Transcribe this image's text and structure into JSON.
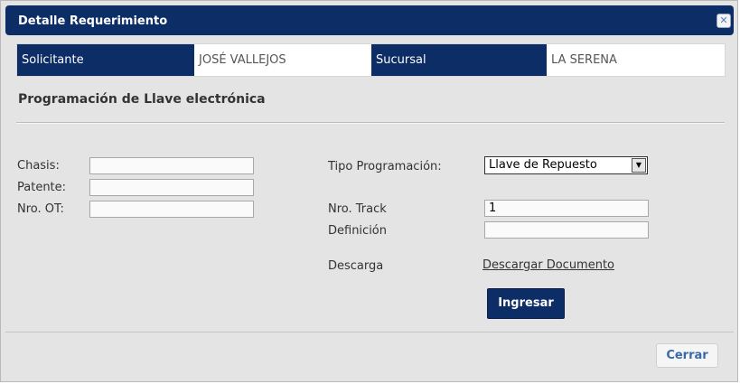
{
  "dialog": {
    "title": "Detalle Requerimiento",
    "close_glyph": "✕"
  },
  "info_bar": {
    "solicitante_label": "Solicitante",
    "solicitante_value": "JOSÉ VALLEJOS",
    "sucursal_label": "Sucursal",
    "sucursal_value": "LA SERENA"
  },
  "section": {
    "title": "Programación de Llave electrónica"
  },
  "form": {
    "chasis_label": "Chasis:",
    "chasis_value": "",
    "patente_label": "Patente:",
    "patente_value": "",
    "ot_label": "Nro. OT:",
    "ot_value": "",
    "tipo_label": "Tipo Programación:",
    "tipo_selected": "Llave de Repuesto",
    "track_label": "Nro. Track",
    "track_value": "1",
    "definicion_label": "Definición",
    "definicion_value": "",
    "descarga_label": "Descarga",
    "descarga_link": "Descargar Documento",
    "submit_label": "Ingresar"
  },
  "footer": {
    "close_label": "Cerrar"
  },
  "colors": {
    "navy": "#0c2d66",
    "dialog_bg": "#e4e4e4",
    "close_text": "#3a69a8"
  }
}
